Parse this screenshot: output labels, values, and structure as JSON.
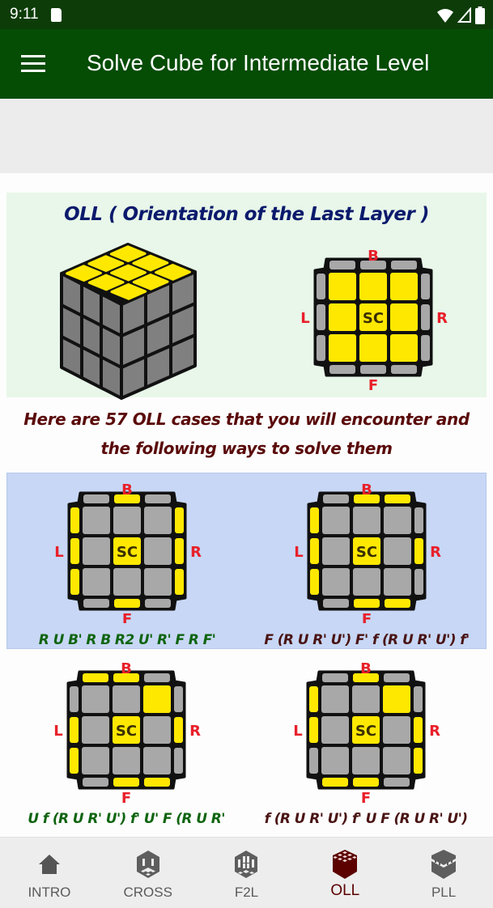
{
  "status_bar": {
    "time": "9:11",
    "icons": [
      "sd-card-icon",
      "wifi-icon",
      "signal-icon",
      "battery-icon"
    ]
  },
  "app_bar": {
    "menu_icon": "hamburger-menu-icon",
    "title": "Solve Cube for Intermediate Level"
  },
  "hero": {
    "title": "OLL ( Orientation of the Last Layer )",
    "face_labels": {
      "back": "B",
      "front": "F",
      "left": "L",
      "right": "R",
      "center": "SC"
    }
  },
  "intro_text": {
    "line1": "Here are 57 OLL cases that you will encounter and",
    "line2": "the following ways to solve them"
  },
  "colors": {
    "yellow": "#ffe800",
    "gray": "#a8a8a8",
    "label_red": "#e8202a",
    "accent_active": "#5c0000",
    "app_bar": "#054c05",
    "status_bar": "#0d3c08"
  },
  "cases": [
    {
      "algorithm": "R U B' R B R2 U' R' F R F'",
      "algorithm_color": "green",
      "top": [
        0,
        1,
        0
      ],
      "grid": [
        [
          0,
          0,
          0
        ],
        [
          0,
          1,
          0
        ],
        [
          0,
          0,
          0
        ]
      ],
      "left": [
        1,
        1,
        1
      ],
      "right": [
        1,
        1,
        1
      ],
      "bottom": [
        0,
        1,
        0
      ]
    },
    {
      "algorithm": "F (R U R' U') F' f (R U R' U') f'",
      "algorithm_color": "brown",
      "top": [
        0,
        1,
        1
      ],
      "grid": [
        [
          0,
          0,
          0
        ],
        [
          0,
          1,
          0
        ],
        [
          0,
          0,
          0
        ]
      ],
      "left": [
        1,
        1,
        1
      ],
      "right": [
        0,
        1,
        0
      ],
      "bottom": [
        0,
        1,
        1
      ]
    },
    {
      "algorithm": "U f (R U R' U') f' U' F (R U R'",
      "algorithm_color": "green",
      "top": [
        1,
        1,
        0
      ],
      "grid": [
        [
          0,
          0,
          1
        ],
        [
          0,
          1,
          0
        ],
        [
          0,
          0,
          0
        ]
      ],
      "left": [
        0,
        1,
        1
      ],
      "right": [
        0,
        1,
        0
      ],
      "bottom": [
        0,
        1,
        1
      ]
    },
    {
      "algorithm": "f (R U R' U') f' U F (R U R' U')",
      "algorithm_color": "brown",
      "top": [
        0,
        1,
        0
      ],
      "grid": [
        [
          0,
          0,
          1
        ],
        [
          0,
          1,
          0
        ],
        [
          0,
          0,
          0
        ]
      ],
      "left": [
        1,
        1,
        0
      ],
      "right": [
        0,
        1,
        1
      ],
      "bottom": [
        1,
        1,
        0
      ]
    }
  ],
  "bottom_nav": {
    "items": [
      {
        "label": "INTRO",
        "icon": "home-icon",
        "active": false
      },
      {
        "label": "CROSS",
        "icon": "cross-cube-icon",
        "active": false
      },
      {
        "label": "F2L",
        "icon": "f2l-cube-icon",
        "active": false
      },
      {
        "label": "OLL",
        "icon": "oll-cube-icon",
        "active": true
      },
      {
        "label": "PLL",
        "icon": "pll-cube-icon",
        "active": false
      }
    ]
  }
}
